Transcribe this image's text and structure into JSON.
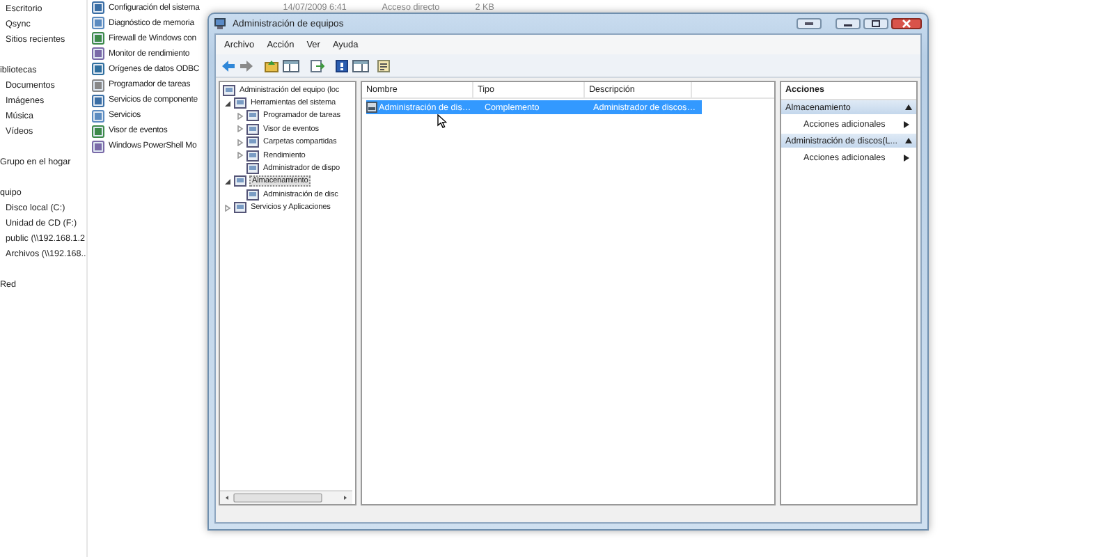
{
  "explorer": {
    "nav": [
      {
        "children": [
          {
            "label": "Escritorio"
          },
          {
            "label": "Qsync"
          },
          {
            "label": "Sitios recientes"
          }
        ]
      },
      {
        "label": "ibliotecas",
        "children": [
          {
            "label": "Documentos"
          },
          {
            "label": "Imágenes"
          },
          {
            "label": "Música"
          },
          {
            "label": "Vídeos"
          }
        ]
      },
      {
        "label": "Grupo en el hogar"
      },
      {
        "label": "quipo",
        "children": [
          {
            "label": "Disco local (C:)"
          },
          {
            "label": "Unidad de CD (F:)"
          },
          {
            "label": "public (\\\\192.168.1.2"
          },
          {
            "label": "Archivos (\\\\192.168.."
          }
        ]
      },
      {
        "label": "Red"
      }
    ],
    "files": [
      {
        "name": "Configuración del sistema",
        "date": "14/07/2009 6:41",
        "type": "Acceso directo",
        "size": "2 KB"
      },
      {
        "name": "Diagnóstico de memoria"
      },
      {
        "name": "Firewall de Windows con"
      },
      {
        "name": "Monitor de rendimiento"
      },
      {
        "name": "Orígenes de datos ODBC"
      },
      {
        "name": "Programador de tareas"
      },
      {
        "name": "Servicios de componente"
      },
      {
        "name": "Servicios"
      },
      {
        "name": "Visor de eventos"
      },
      {
        "name": "Windows PowerShell Mo"
      }
    ]
  },
  "window": {
    "title": "Administración de equipos",
    "menu": [
      "Archivo",
      "Acción",
      "Ver",
      "Ayuda"
    ],
    "tree": [
      {
        "label": "Administración del equipo (loc",
        "selected": false,
        "children": [
          {
            "label": "Herramientas del sistema",
            "expanded": true,
            "selected": false,
            "children": [
              {
                "label": "Programador de tareas",
                "expanded": false,
                "selected": false
              },
              {
                "label": "Visor de eventos",
                "expanded": false,
                "selected": false
              },
              {
                "label": "Carpetas compartidas",
                "expanded": false,
                "selected": false
              },
              {
                "label": "Rendimiento",
                "expanded": false,
                "selected": false
              },
              {
                "label": "Administrador de dispo",
                "selected": false
              }
            ]
          },
          {
            "label": "Almacenamiento",
            "expanded": true,
            "selected": true,
            "children": [
              {
                "label": "Administración de disc",
                "selected": false
              }
            ]
          },
          {
            "label": "Servicios y Aplicaciones",
            "expanded": false,
            "selected": false
          }
        ]
      }
    ],
    "list": {
      "columns": [
        "Nombre",
        "Tipo",
        "Descripción"
      ],
      "rows": [
        {
          "cells": [
            "Administración de dis…",
            "Complemento",
            "Administrador de discos…"
          ],
          "selected": true
        }
      ]
    },
    "actions": {
      "title": "Acciones",
      "sections": [
        {
          "title": "Almacenamiento",
          "items": [
            "Acciones adicionales"
          ]
        },
        {
          "title": "Administración de discos(L...",
          "items": [
            "Acciones adicionales"
          ]
        }
      ]
    }
  }
}
